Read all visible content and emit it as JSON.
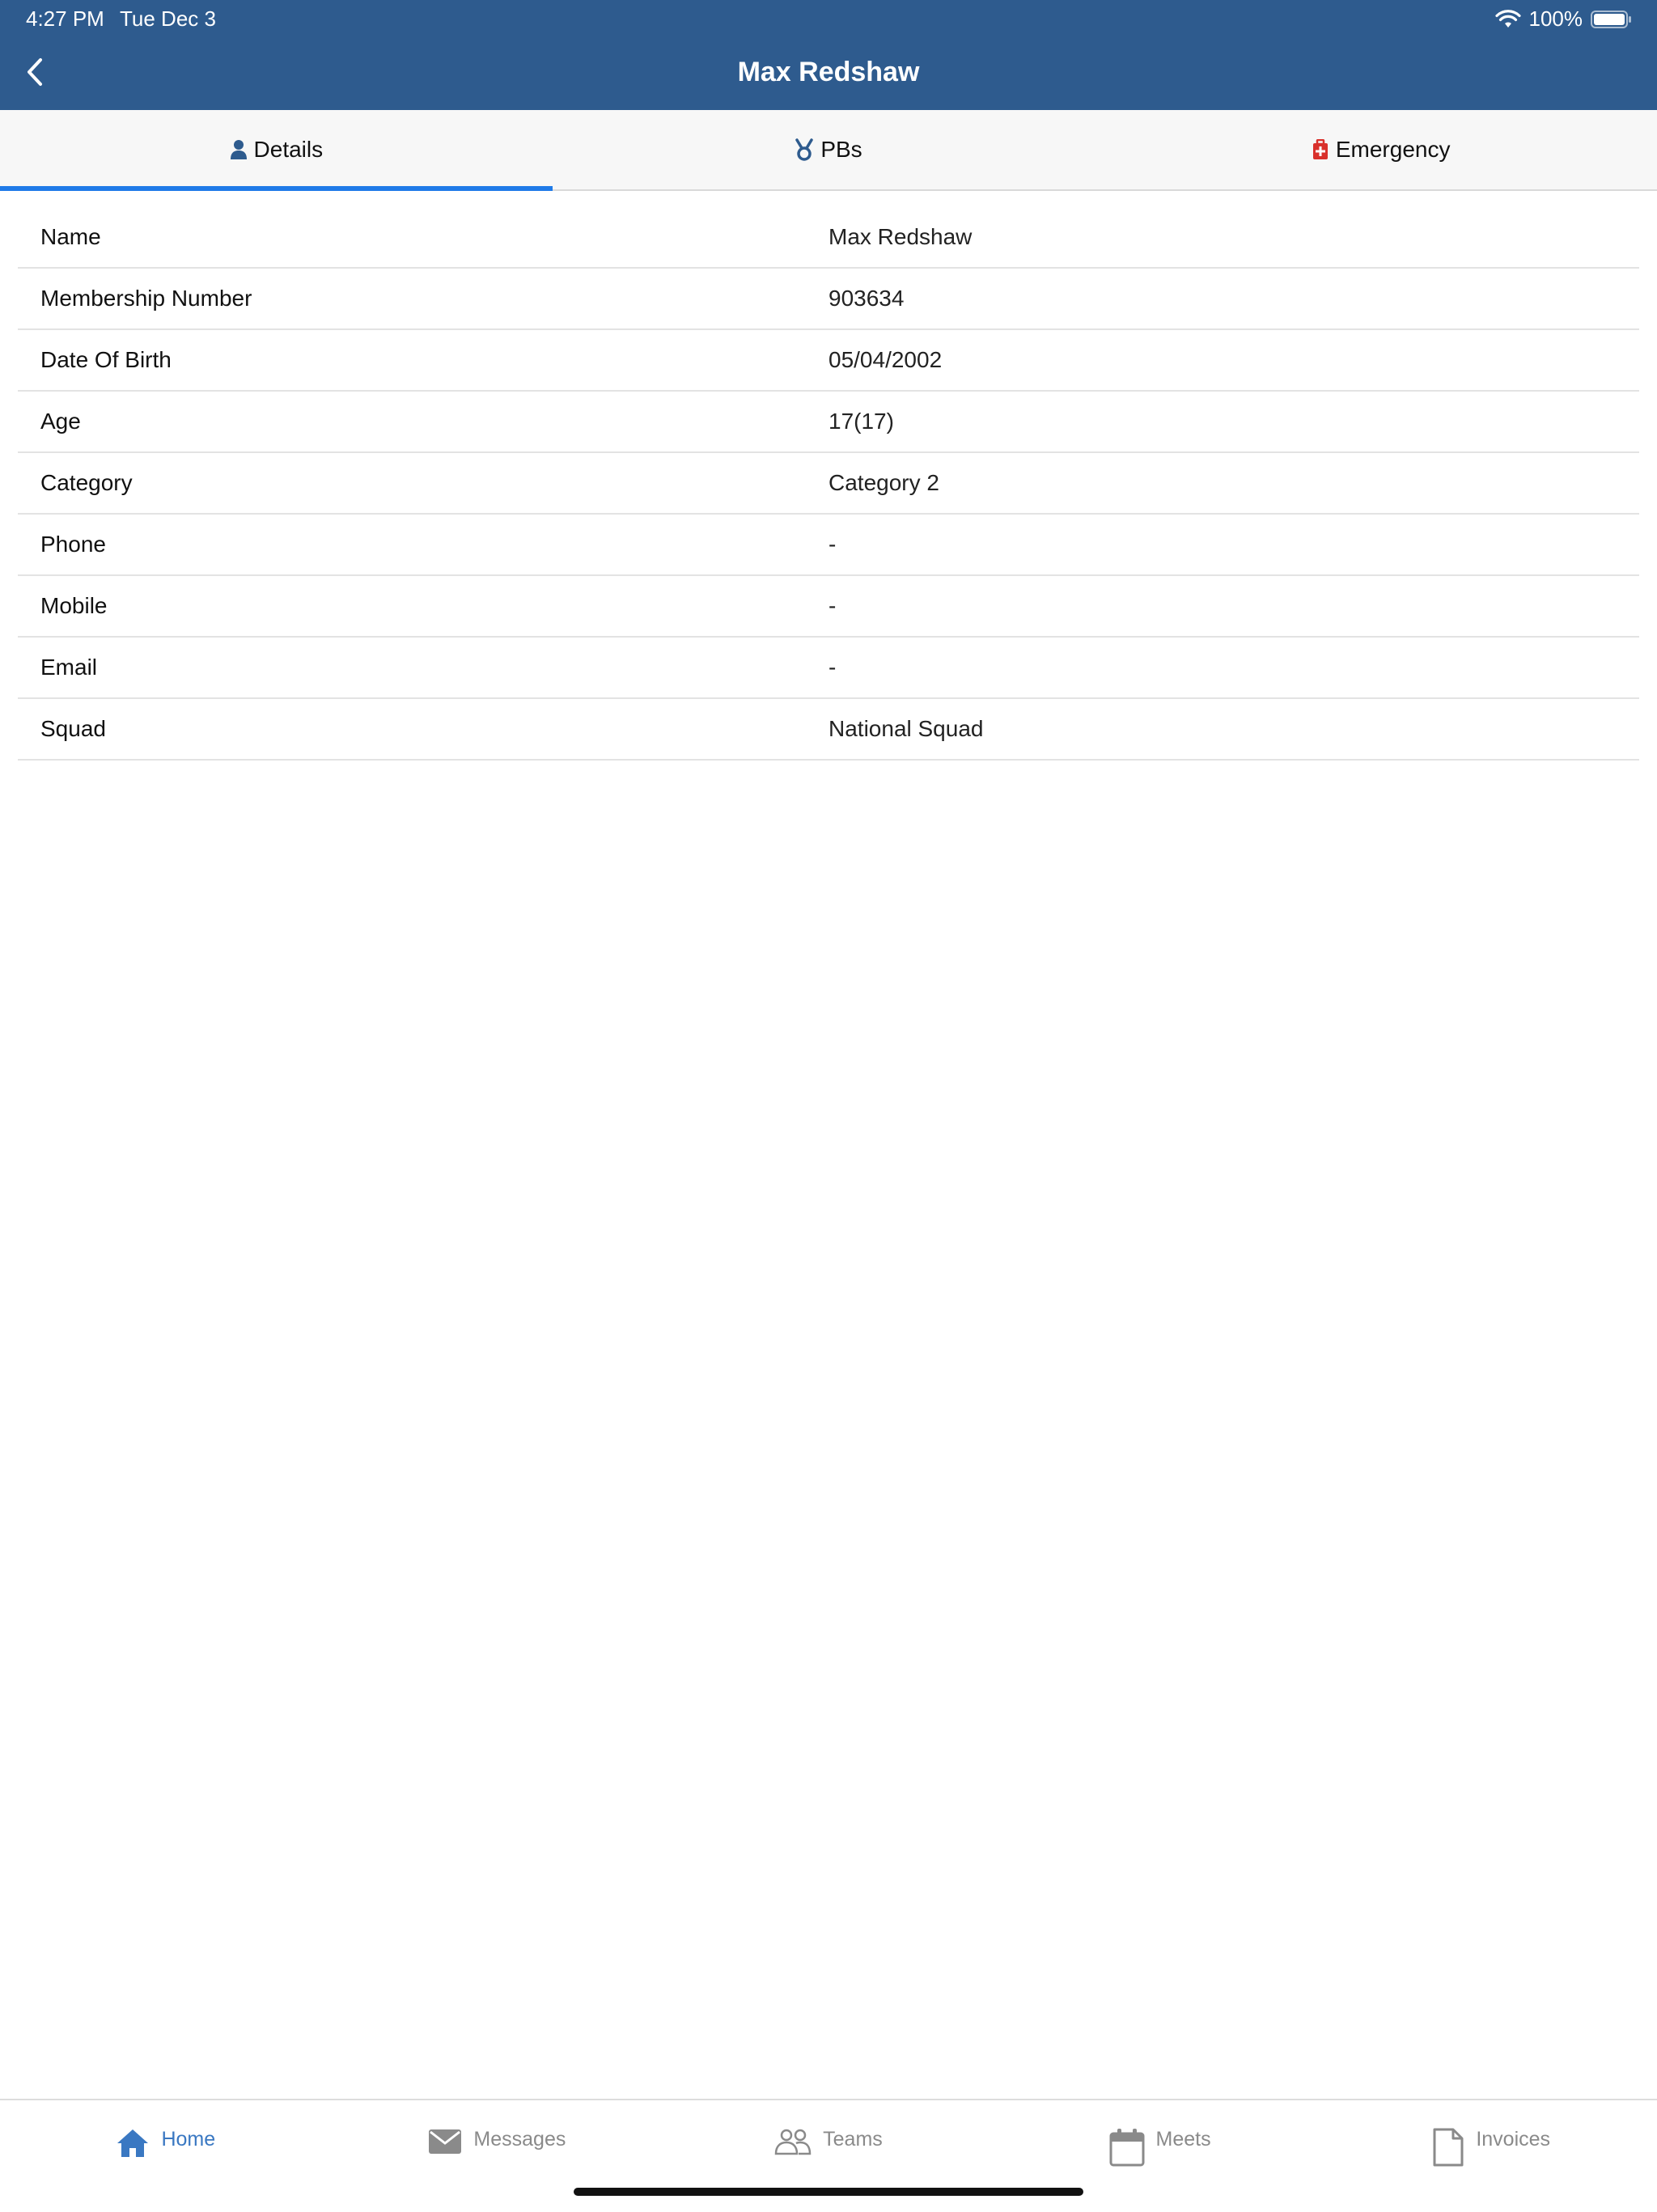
{
  "status_bar": {
    "time": "4:27 PM",
    "date": "Tue Dec 3",
    "battery": "100%"
  },
  "nav": {
    "title": "Max Redshaw"
  },
  "tabs": [
    {
      "label": "Details",
      "icon": "person-icon",
      "active": true
    },
    {
      "label": "PBs",
      "icon": "medal-icon",
      "active": false
    },
    {
      "label": "Emergency",
      "icon": "medical-bag-icon",
      "active": false,
      "icon_color": "#d9302b"
    }
  ],
  "details": [
    {
      "label": "Name",
      "value": "Max Redshaw"
    },
    {
      "label": "Membership Number",
      "value": "903634"
    },
    {
      "label": "Date Of Birth",
      "value": "05/04/2002"
    },
    {
      "label": "Age",
      "value": "17(17)"
    },
    {
      "label": "Category",
      "value": "Category 2"
    },
    {
      "label": "Phone",
      "value": "-"
    },
    {
      "label": "Mobile",
      "value": "-"
    },
    {
      "label": "Email",
      "value": "-"
    },
    {
      "label": "Squad",
      "value": "National Squad"
    }
  ],
  "bottom_tabs": [
    {
      "label": "Home",
      "icon": "home-icon",
      "active": true
    },
    {
      "label": "Messages",
      "icon": "envelope-icon",
      "active": false
    },
    {
      "label": "Teams",
      "icon": "people-icon",
      "active": false
    },
    {
      "label": "Meets",
      "icon": "calendar-icon",
      "active": false
    },
    {
      "label": "Invoices",
      "icon": "document-icon",
      "active": false
    }
  ],
  "colors": {
    "header_bg": "#2e5b8e",
    "tab_indicator": "#1f7ae8",
    "active_bottom_tab": "#3a78c2",
    "inactive_bottom_tab": "#8a8a8a"
  }
}
